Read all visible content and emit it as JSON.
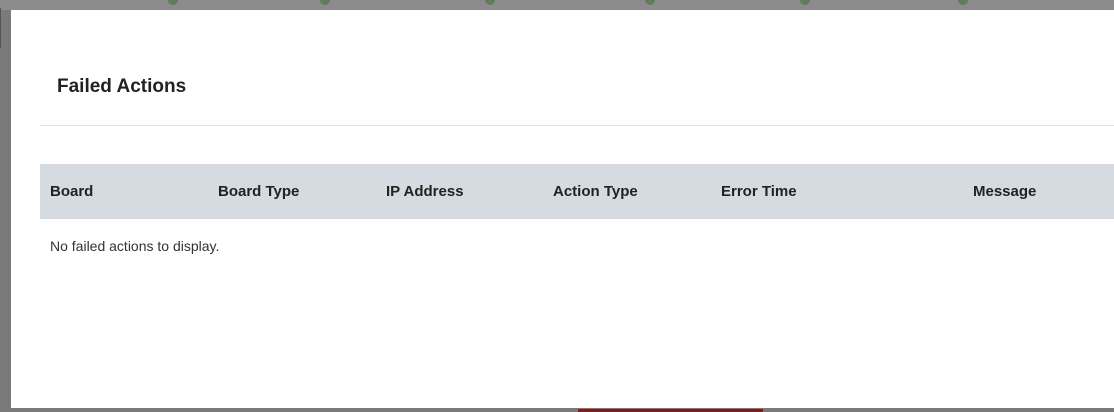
{
  "dialog": {
    "title": "Failed Actions"
  },
  "table": {
    "columns": [
      "Board",
      "Board Type",
      "IP Address",
      "Action Type",
      "Error Time",
      "Message"
    ],
    "rows": [],
    "empty_message": "No failed actions to display."
  },
  "colors": {
    "header_background": "#d5dbe0",
    "dialog_background": "#ffffff",
    "overlay": "#7a7a7a",
    "accent": "#7a1d1d"
  }
}
